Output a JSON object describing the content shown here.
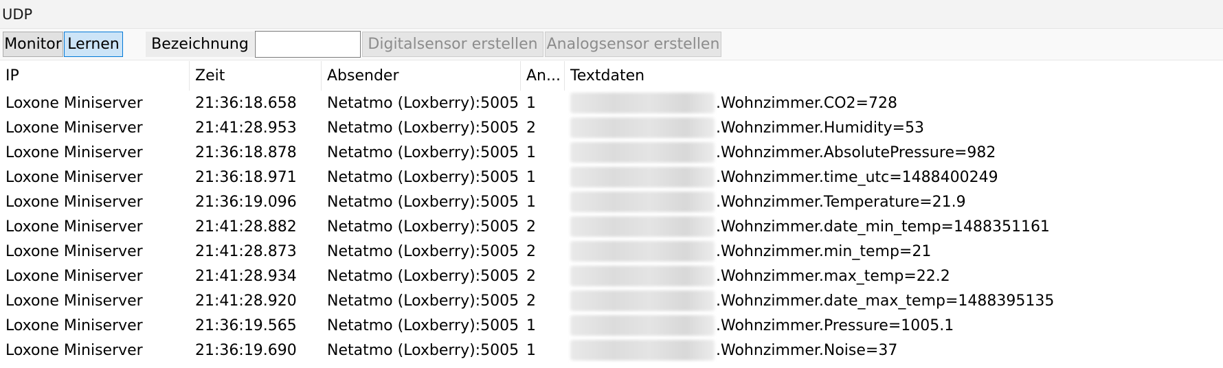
{
  "window": {
    "title": "UDP"
  },
  "toolbar": {
    "monitor_label": "Monitor",
    "lernen_label": "Lernen",
    "bezeichnung_label": "Bezeichnung",
    "bezeichnung_value": "",
    "digital_label": "Digitalsensor erstellen",
    "analog_label": "Analogsensor erstellen"
  },
  "table": {
    "headers": {
      "ip": "IP",
      "zeit": "Zeit",
      "absender": "Absender",
      "anzahl": "An...",
      "textdaten": "Textdaten"
    },
    "rows": [
      {
        "ip": "Loxone Miniserver",
        "zeit": "21:36:18.658",
        "absender": "Netatmo (Loxberry):5005 ...",
        "anzahl": "1",
        "text": ".Wohnzimmer.CO2=728"
      },
      {
        "ip": "Loxone Miniserver",
        "zeit": "21:41:28.953",
        "absender": "Netatmo (Loxberry):5005 ...",
        "anzahl": "2",
        "text": ".Wohnzimmer.Humidity=53"
      },
      {
        "ip": "Loxone Miniserver",
        "zeit": "21:36:18.878",
        "absender": "Netatmo (Loxberry):5005 ...",
        "anzahl": "1",
        "text": ".Wohnzimmer.AbsolutePressure=982"
      },
      {
        "ip": "Loxone Miniserver",
        "zeit": "21:36:18.971",
        "absender": "Netatmo (Loxberry):5005 ...",
        "anzahl": "1",
        "text": ".Wohnzimmer.time_utc=1488400249"
      },
      {
        "ip": "Loxone Miniserver",
        "zeit": "21:36:19.096",
        "absender": "Netatmo (Loxberry):5005 ...",
        "anzahl": "1",
        "text": ".Wohnzimmer.Temperature=21.9"
      },
      {
        "ip": "Loxone Miniserver",
        "zeit": "21:41:28.882",
        "absender": "Netatmo (Loxberry):5005 ...",
        "anzahl": "2",
        "text": ".Wohnzimmer.date_min_temp=1488351161"
      },
      {
        "ip": "Loxone Miniserver",
        "zeit": "21:41:28.873",
        "absender": "Netatmo (Loxberry):5005 ...",
        "anzahl": "2",
        "text": ".Wohnzimmer.min_temp=21"
      },
      {
        "ip": "Loxone Miniserver",
        "zeit": "21:41:28.934",
        "absender": "Netatmo (Loxberry):5005 ...",
        "anzahl": "2",
        "text": ".Wohnzimmer.max_temp=22.2"
      },
      {
        "ip": "Loxone Miniserver",
        "zeit": "21:41:28.920",
        "absender": "Netatmo (Loxberry):5005 ...",
        "anzahl": "2",
        "text": ".Wohnzimmer.date_max_temp=1488395135"
      },
      {
        "ip": "Loxone Miniserver",
        "zeit": "21:36:19.565",
        "absender": "Netatmo (Loxberry):5005 ...",
        "anzahl": "1",
        "text": ".Wohnzimmer.Pressure=1005.1"
      },
      {
        "ip": "Loxone Miniserver",
        "zeit": "21:36:19.690",
        "absender": "Netatmo (Loxberry):5005 ...",
        "anzahl": "1",
        "text": ".Wohnzimmer.Noise=37"
      }
    ]
  }
}
